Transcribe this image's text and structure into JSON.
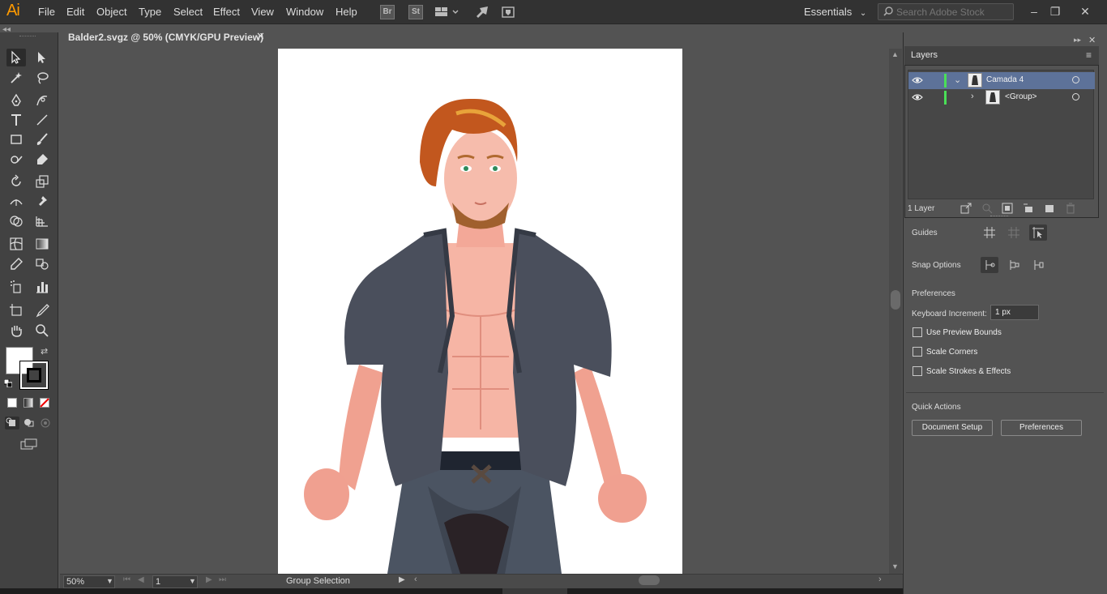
{
  "app": {
    "logo": "Ai"
  },
  "menu": [
    "File",
    "Edit",
    "Object",
    "Type",
    "Select",
    "Effect",
    "View",
    "Window",
    "Help"
  ],
  "menubar_icons": {
    "br": "Br",
    "st": "St"
  },
  "workspace": {
    "label": "Essentials"
  },
  "search": {
    "placeholder": "Search Adobe Stock"
  },
  "document": {
    "tab_title": "Balder2.svgz @ 50% (CMYK/GPU Preview)"
  },
  "status": {
    "zoom": "50%",
    "page": "1",
    "tool": "Group Selection"
  },
  "layers": {
    "title": "Layers",
    "rows": [
      {
        "name": "Camada 4",
        "expanded": true
      },
      {
        "name": "<Group>",
        "expanded": false
      }
    ],
    "count": "1 Layer",
    "layer_color": "#4adf57"
  },
  "properties": {
    "guides_label": "Guides",
    "snap_label": "Snap Options",
    "preferences_section": "Preferences",
    "keyboard_increment_label": "Keyboard Increment:",
    "keyboard_increment_value": "1 px",
    "checkboxes": [
      "Use Preview Bounds",
      "Scale Corners",
      "Scale Strokes & Effects"
    ],
    "quick_actions_label": "Quick Actions",
    "document_setup_button": "Document Setup",
    "preferences_button": "Preferences"
  },
  "colors": {
    "selection": "#5d7299",
    "logo": "#ff9a00"
  }
}
